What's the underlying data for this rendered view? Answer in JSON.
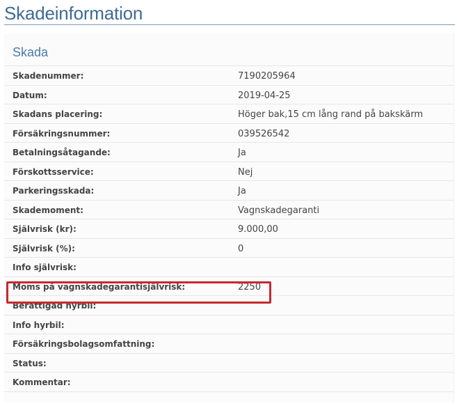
{
  "page": {
    "title": "Skadeinformation"
  },
  "section": {
    "title": "Skada",
    "rows": [
      {
        "label": "Skadenummer:",
        "value": "7190205964"
      },
      {
        "label": "Datum:",
        "value": "2019-04-25"
      },
      {
        "label": "Skadans placering:",
        "value": "Höger bak,15 cm lång rand på bakskärm"
      },
      {
        "label": "Försäkringsnummer:",
        "value": "039526542"
      },
      {
        "label": "Betalningsåtagande:",
        "value": "Ja"
      },
      {
        "label": "Förskottsservice:",
        "value": "Nej"
      },
      {
        "label": "Parkeringsskada:",
        "value": "Ja"
      },
      {
        "label": "Skademoment:",
        "value": "Vagnskadegaranti"
      },
      {
        "label": "Självrisk (kr):",
        "value": "9.000,00"
      },
      {
        "label": "Självrisk (%):",
        "value": "0"
      },
      {
        "label": "Info självrisk:",
        "value": ""
      },
      {
        "label": "Moms på vagnskadegarantisjälvrisk:",
        "value": "2250"
      },
      {
        "label": "Berättigad hyrbil:",
        "value": ""
      },
      {
        "label": "Info hyrbil:",
        "value": ""
      },
      {
        "label": "Försäkringsbolagsomfattning:",
        "value": ""
      },
      {
        "label": "Status:",
        "value": ""
      },
      {
        "label": "Kommentar:",
        "value": ""
      }
    ]
  },
  "colors": {
    "title": "#3f6b93",
    "section_title": "#4a7aa6",
    "highlight": "#c6282f",
    "text": "#444444"
  }
}
